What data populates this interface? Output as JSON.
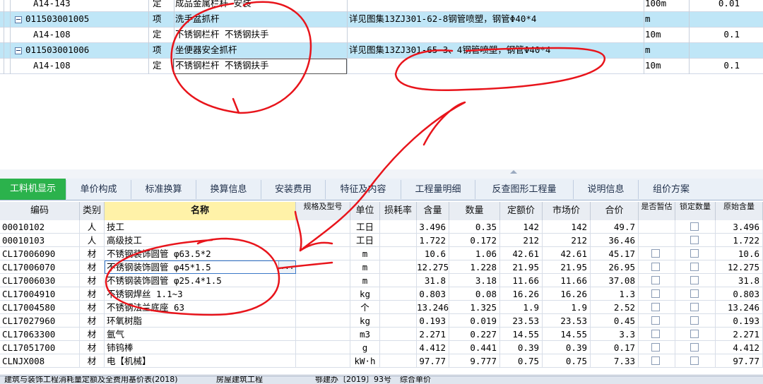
{
  "top_rows": [
    {
      "code": "A14-143",
      "type": "定",
      "name": "成品金属栏杆 安装",
      "feature": "",
      "unit": "100m",
      "qty": "0.01",
      "kind": "sub"
    },
    {
      "code": "011503001005",
      "type": "项",
      "name": "洗手盆抓杆",
      "feature": "详见图集13ZJ301-62-8钢管喷塑，钢管Φ40*4",
      "unit": "m",
      "qty": "",
      "kind": "item"
    },
    {
      "code": "A14-108",
      "type": "定",
      "name": "不锈钢栏杆 不锈钢扶手",
      "feature": "",
      "unit": "10m",
      "qty": "0.1",
      "kind": "sub"
    },
    {
      "code": "011503001006",
      "type": "项",
      "name": "坐便器安全抓杆",
      "feature": "详见图集13ZJ301-65-3、4钢管喷塑，钢管Φ40*4",
      "unit": "m",
      "qty": "",
      "kind": "item"
    },
    {
      "code": "A14-108",
      "type": "定",
      "name": "不锈钢栏杆 不锈钢扶手",
      "feature": "",
      "unit": "10m",
      "qty": "0.1",
      "kind": "sub"
    }
  ],
  "tabs": [
    "工料机显示",
    "单价构成",
    "标准换算",
    "换算信息",
    "安装费用",
    "特征及内容",
    "工程量明细",
    "反查图形工程量",
    "说明信息",
    "组价方案"
  ],
  "headers": {
    "code": "编码",
    "type": "类别",
    "name": "名称",
    "spec": "规格及型号",
    "unit": "单位",
    "loss": "损耗率",
    "content": "含量",
    "qty": "数量",
    "quota_price": "定额价",
    "market_price": "市场价",
    "total_price": "合价",
    "is_estimate": "是否暂估",
    "lock_qty": "锁定数量",
    "orig_content": "原始含量"
  },
  "grid_rows": [
    {
      "code": "00010102",
      "type": "人",
      "name": "技工",
      "unit": "工日",
      "content": "3.496",
      "qty": "0.35",
      "quota": "142",
      "market": "142",
      "total": "49.7",
      "orig": "3.496",
      "cb": false
    },
    {
      "code": "00010103",
      "type": "人",
      "name": "高级技工",
      "unit": "工日",
      "content": "1.722",
      "qty": "0.172",
      "quota": "212",
      "market": "212",
      "total": "36.46",
      "orig": "1.722",
      "cb": false
    },
    {
      "code": "CL17006090",
      "type": "材",
      "name": "不锈钢装饰圆管 φ63.5*2",
      "unit": "m",
      "content": "10.6",
      "qty": "1.06",
      "quota": "42.61",
      "market": "42.61",
      "total": "45.17",
      "orig": "10.6",
      "cb": true
    },
    {
      "code": "CL17006070",
      "type": "材",
      "name": "不锈钢装饰圆管 φ45*1.5",
      "unit": "m",
      "content": "12.275",
      "qty": "1.228",
      "quota": "21.95",
      "market": "21.95",
      "total": "26.95",
      "orig": "12.275",
      "cb": true
    },
    {
      "code": "CL17006030",
      "type": "材",
      "name": "不锈钢装饰圆管 φ25.4*1.5",
      "unit": "m",
      "content": "31.8",
      "qty": "3.18",
      "quota": "11.66",
      "market": "11.66",
      "total": "37.08",
      "orig": "31.8",
      "cb": true
    },
    {
      "code": "CL17004910",
      "type": "材",
      "name": "不锈钢焊丝 1.1~3",
      "unit": "kg",
      "content": "0.803",
      "qty": "0.08",
      "quota": "16.26",
      "market": "16.26",
      "total": "1.3",
      "orig": "0.803",
      "cb": true
    },
    {
      "code": "CL17004580",
      "type": "材",
      "name": "不锈钢法兰底座 63",
      "unit": "个",
      "content": "13.246",
      "qty": "1.325",
      "quota": "1.9",
      "market": "1.9",
      "total": "2.52",
      "orig": "13.246",
      "cb": true
    },
    {
      "code": "CL17027960",
      "type": "材",
      "name": "环氧树脂",
      "unit": "kg",
      "content": "0.193",
      "qty": "0.019",
      "quota": "23.53",
      "market": "23.53",
      "total": "0.45",
      "orig": "0.193",
      "cb": true
    },
    {
      "code": "CL17063300",
      "type": "材",
      "name": "氩气",
      "unit": "m3",
      "content": "2.271",
      "qty": "0.227",
      "quota": "14.55",
      "market": "14.55",
      "total": "3.3",
      "orig": "2.271",
      "cb": true
    },
    {
      "code": "CL17051700",
      "type": "材",
      "name": "铈钨棒",
      "unit": "g",
      "content": "4.412",
      "qty": "0.441",
      "quota": "0.39",
      "market": "0.39",
      "total": "0.17",
      "orig": "4.412",
      "cb": true
    },
    {
      "code": "CLNJX008",
      "type": "材",
      "name": "电【机械】",
      "unit": "kW·h",
      "content": "97.77",
      "qty": "9.777",
      "quota": "0.75",
      "market": "0.75",
      "total": "7.33",
      "orig": "97.77",
      "cb": true
    }
  ],
  "status_items": [
    "建筑与装饰工程消耗量定额及全费用基价表(2018)",
    "房屋建筑工程",
    "鄂建办〔2019〕93号",
    "综合单价"
  ],
  "edit_button": "...",
  "annotation_color": "#e8141b"
}
